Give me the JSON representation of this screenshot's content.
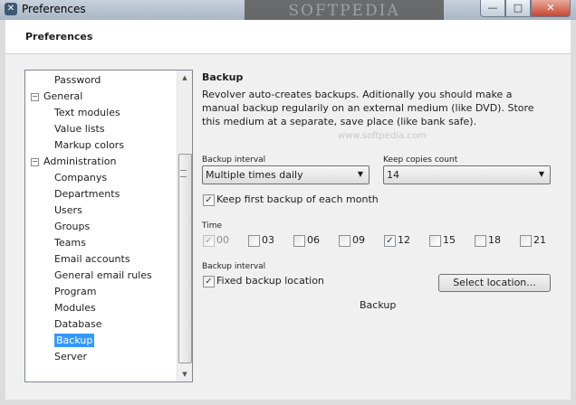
{
  "window": {
    "title": "Preferences",
    "watermark": "SOFTPEDIA",
    "buttons": {
      "minimize": "—",
      "maximize": "□",
      "close": "✕"
    }
  },
  "header": {
    "title": "Preferences"
  },
  "tree": {
    "items": [
      {
        "label": "Password",
        "level": 1
      },
      {
        "label": "General",
        "level": 0,
        "expander": "−"
      },
      {
        "label": "Text modules",
        "level": 1
      },
      {
        "label": "Value lists",
        "level": 1
      },
      {
        "label": "Markup colors",
        "level": 1
      },
      {
        "label": "Administration",
        "level": 0,
        "expander": "−"
      },
      {
        "label": "Companys",
        "level": 1
      },
      {
        "label": "Departments",
        "level": 1
      },
      {
        "label": "Users",
        "level": 1
      },
      {
        "label": "Groups",
        "level": 1
      },
      {
        "label": "Teams",
        "level": 1
      },
      {
        "label": "Email accounts",
        "level": 1
      },
      {
        "label": "General email rules",
        "level": 1
      },
      {
        "label": "Program",
        "level": 1
      },
      {
        "label": "Modules",
        "level": 1
      },
      {
        "label": "Database",
        "level": 1
      },
      {
        "label": "Backup",
        "level": 1,
        "selected": true
      },
      {
        "label": "Server",
        "level": 1
      }
    ]
  },
  "backup": {
    "title": "Backup",
    "description": "Revolver auto-creates backups. Aditionally you should make a manual backup regularily on an external medium (like DVD). Store this medium at a separate, save place (like bank safe).",
    "watermark": "www.softpedia.com",
    "interval_label": "Backup interval",
    "interval_value": "Multiple times daily",
    "copies_label": "Keep copies count",
    "copies_value": "14",
    "keep_monthly_label": "Keep first backup of each month",
    "keep_monthly_checked": true,
    "time_label": "Time",
    "times": [
      {
        "label": "00",
        "checked": true,
        "disabled": true
      },
      {
        "label": "03",
        "checked": false
      },
      {
        "label": "06",
        "checked": false
      },
      {
        "label": "09",
        "checked": false
      },
      {
        "label": "12",
        "checked": true
      },
      {
        "label": "15",
        "checked": false
      },
      {
        "label": "18",
        "checked": false
      },
      {
        "label": "21",
        "checked": false
      }
    ],
    "location_section_label": "Backup interval",
    "fixed_location_label": "Fixed backup location",
    "fixed_location_checked": true,
    "select_location_button": "Select location...",
    "location_value": "Backup"
  },
  "colors": {
    "selection": "#3399ff",
    "check": "#2b3a75"
  }
}
